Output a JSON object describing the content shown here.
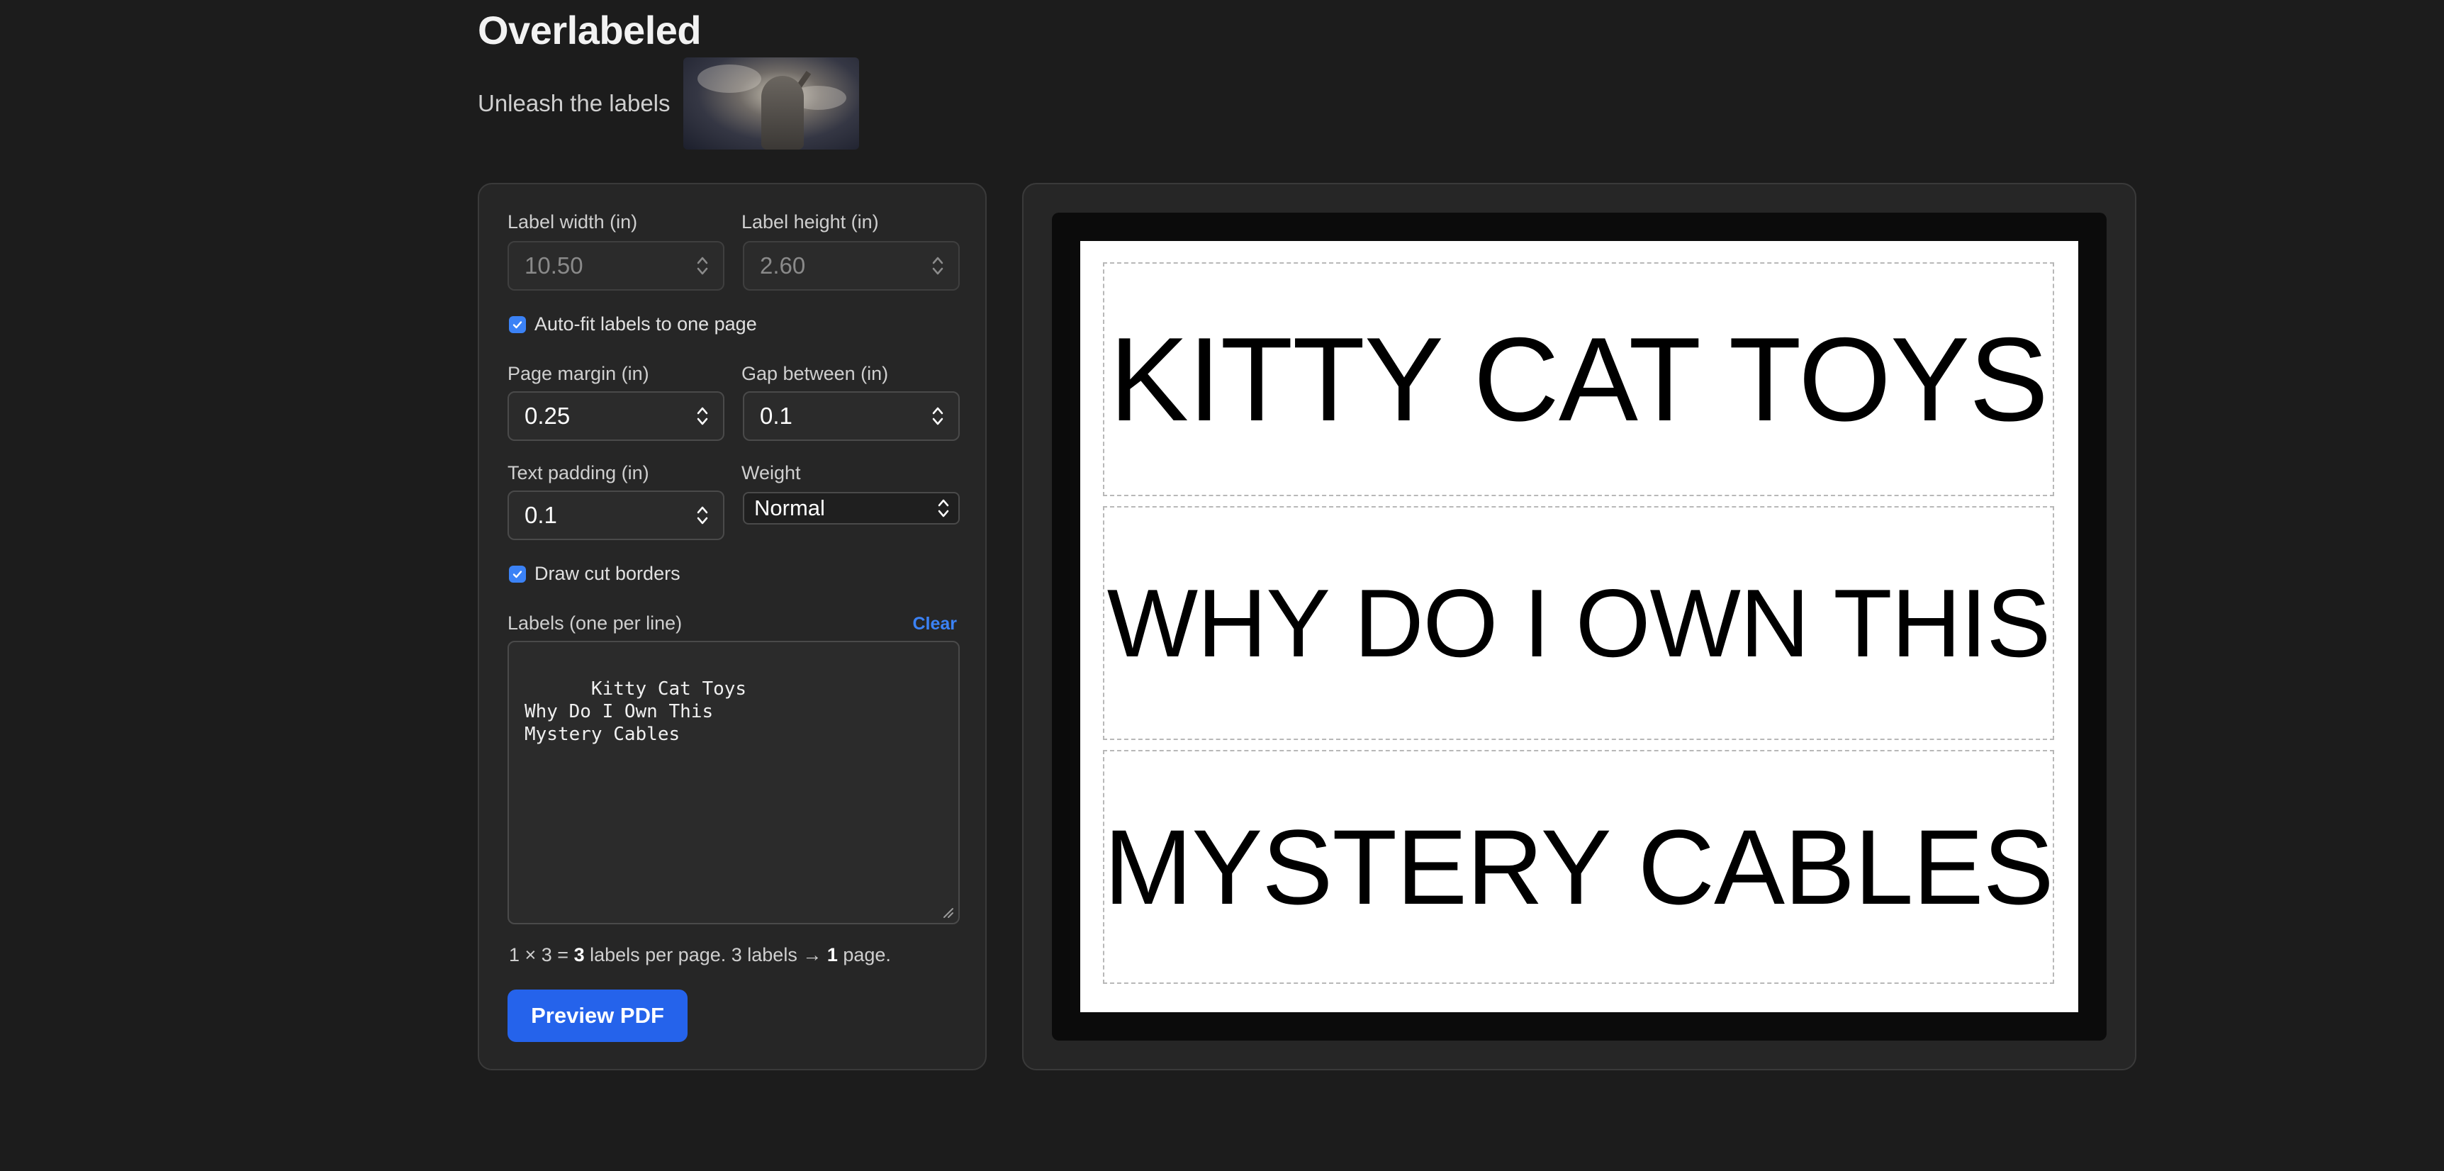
{
  "header": {
    "title": "Overlabeled",
    "tagline": "Unleash the labels"
  },
  "controls": {
    "label_width": {
      "label": "Label width (in)",
      "value": "10.50"
    },
    "label_height": {
      "label": "Label height (in)",
      "value": "2.60"
    },
    "auto_fit": {
      "label": "Auto-fit labels to one page",
      "checked": true
    },
    "page_margin": {
      "label": "Page margin (in)",
      "value": "0.25"
    },
    "gap_between": {
      "label": "Gap between (in)",
      "value": "0.1"
    },
    "text_padding": {
      "label": "Text padding (in)",
      "value": "0.1"
    },
    "weight": {
      "label": "Weight",
      "value": "Normal"
    },
    "draw_cut_borders": {
      "label": "Draw cut borders",
      "checked": true
    },
    "labels_field": {
      "label": "Labels (one per line)",
      "clear_label": "Clear",
      "value": "Kitty Cat Toys\nWhy Do I Own This\nMystery Cables"
    },
    "summary": {
      "grid": "1 × 3 = ",
      "per_page": "3",
      "per_page_text": " labels per page. 3 labels → ",
      "pages": "1",
      "pages_text": " page."
    },
    "preview_button": "Preview PDF"
  },
  "preview": {
    "labels": [
      "Kitty Cat Toys",
      "Why Do I Own This",
      "Mystery Cables"
    ]
  },
  "colors": {
    "accent": "#2563eb",
    "link": "#3b82f6",
    "background": "#1c1c1c",
    "panel": "#262626"
  }
}
